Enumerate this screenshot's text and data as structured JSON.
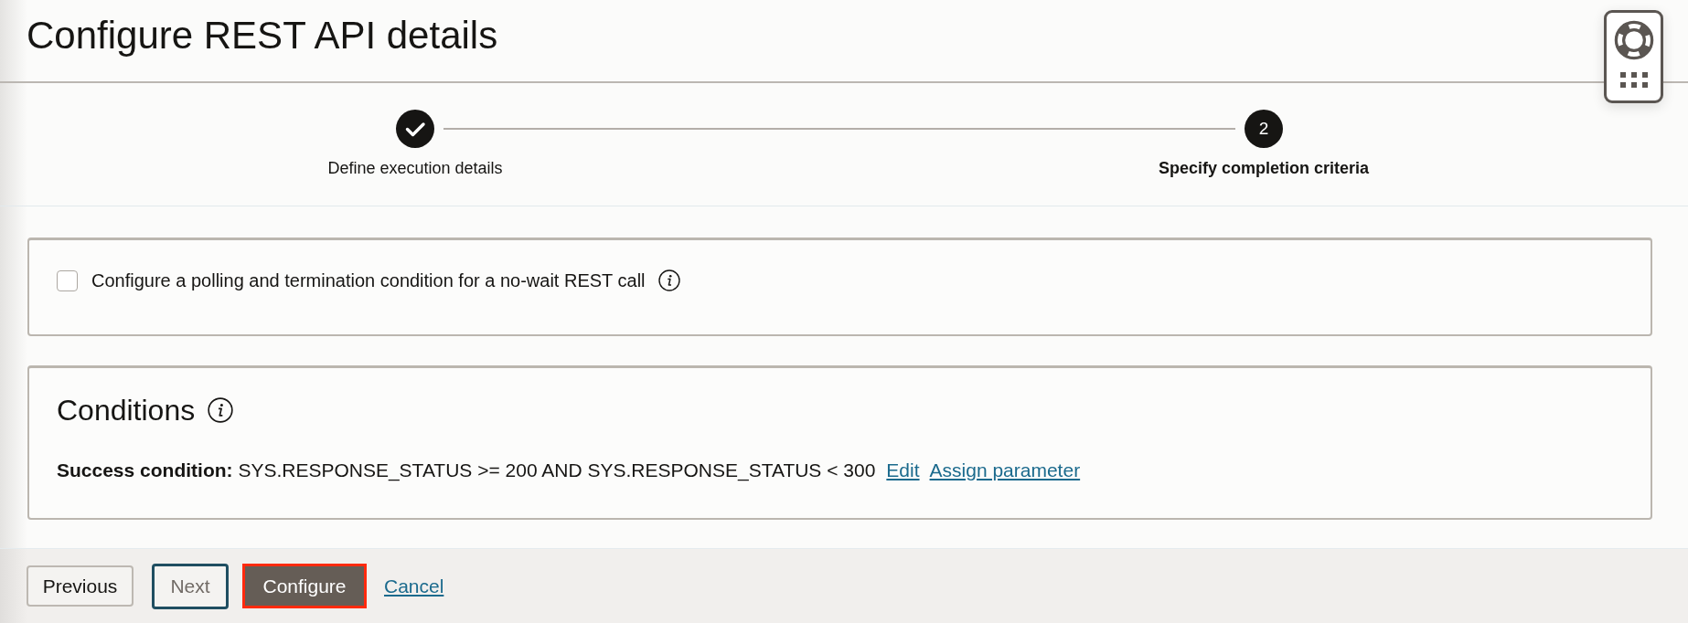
{
  "header": {
    "title": "Configure REST API details"
  },
  "stepper": {
    "steps": [
      {
        "label": "Define execution details",
        "completed": true,
        "selected": false
      },
      {
        "number": "2",
        "label": "Specify completion criteria",
        "completed": false,
        "selected": true
      }
    ]
  },
  "polling_panel": {
    "checkbox": {
      "label": "Configure a polling and termination condition for a no-wait REST call",
      "checked": false
    }
  },
  "conditions_panel": {
    "title": "Conditions",
    "success_condition": "**Success condition:** SYS.RESPONSE_STATUS >= 200 AND SYS.RESPONSE_STATUS < 300",
    "edit_link": "Edit",
    "assign_link": "Assign parameter"
  },
  "footer": {
    "previous": {
      "label": "Previous",
      "disabled": false,
      "focused": false
    },
    "next": {
      "label": "Next",
      "disabled": true,
      "focused": true
    },
    "configure": {
      "label": "Configure",
      "highlighted": true
    },
    "cancel": "Cancel"
  }
}
